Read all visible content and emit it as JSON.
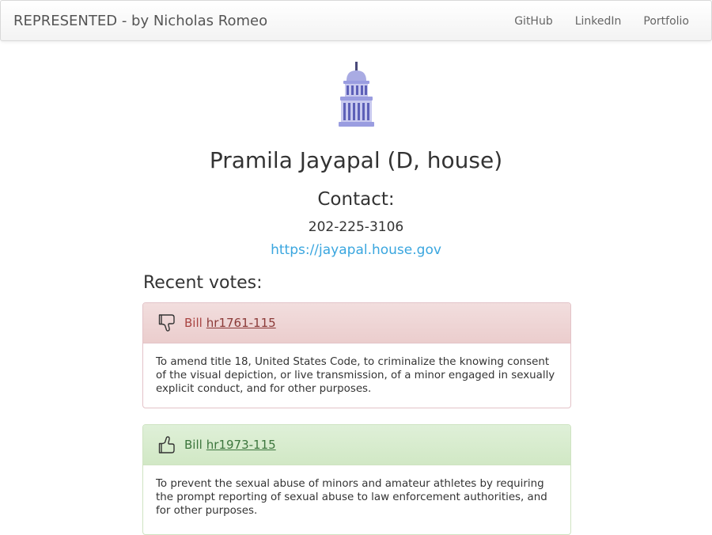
{
  "navbar": {
    "brand": "REPRESENTED - by Nicholas Romeo",
    "links": [
      "GitHub",
      "LinkedIn",
      "Portfolio"
    ]
  },
  "profile": {
    "name": "Pramila Jayapal (D, house)",
    "contact_heading": "Contact:",
    "phone": "202-225-3106",
    "website": "https://jayapal.house.gov"
  },
  "votes_heading": "Recent votes:",
  "votes": [
    {
      "vote": "nay",
      "icon": "thumbs-down-icon",
      "bill_prefix": "Bill",
      "bill_id": "hr1761-115",
      "description": "To amend title 18, United States Code, to criminalize the knowing consent of the visual depiction, or live transmission, of a minor engaged in sexually explicit conduct, and for other purposes."
    },
    {
      "vote": "yea",
      "icon": "thumbs-up-icon",
      "bill_prefix": "Bill",
      "bill_id": "hr1973-115",
      "description": "To prevent the sexual abuse of minors and amateur athletes by requiring the prompt reporting of sexual abuse to law enforcement authorities, and for other purposes."
    }
  ],
  "colors": {
    "link": "#3aa6df",
    "nay_header": "#f2dede",
    "nay_text": "#a94442",
    "yea_header": "#dff0d8",
    "yea_text": "#3c763d",
    "capitol_icon": "#8c8fd6"
  }
}
